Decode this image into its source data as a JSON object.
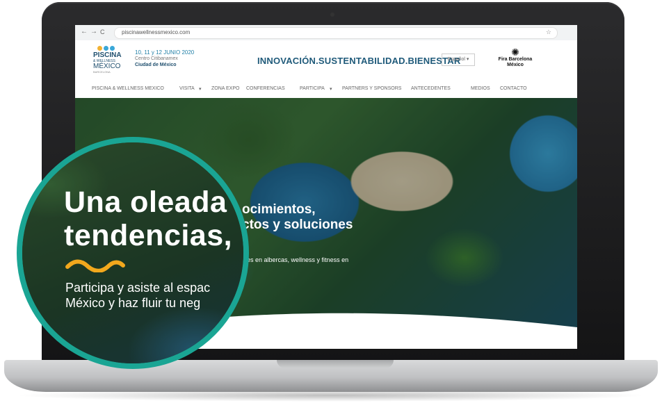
{
  "browser": {
    "url": "piscinawellnessmexico.com",
    "back_icon": "←",
    "forward_icon": "→",
    "reload_icon": "C",
    "star_icon": "☆"
  },
  "header": {
    "logo": {
      "line1": "PISCINA",
      "line2": "& WELLNESS",
      "line3": "MÉXICO",
      "line4": "BARCELONA",
      "dot_colors": [
        "#f2b233",
        "#3aa7d8",
        "#3aa7d8"
      ]
    },
    "event": {
      "dates": "10, 11 y 12 JUNIO 2020",
      "venue": "Centro Citibanamex",
      "city": "Ciudad de México"
    },
    "tagline": "INNOVACIÓN.SUSTENTABILIDAD.BIENESTAR",
    "language": "Español ▾",
    "partner": {
      "line1": "Fira Barcelona",
      "line2": "México"
    }
  },
  "menu": {
    "items": [
      "PISCINA & WELLNESS MEXICO",
      "VISITA",
      "ZONA EXPO",
      "CONFERENCIAS",
      "PARTICIPA",
      "PARTNERS Y SPONSORS",
      "ANTECEDENTES",
      "MEDIOS",
      "CONTACTO"
    ],
    "visita_caret": "▾",
    "participa_caret": "▾"
  },
  "hero": {
    "headline_line1": "ocimientos,",
    "headline_line2": "ctos y soluciones",
    "subtitle": "ales en albercas, wellness y fitness en"
  },
  "magnifier": {
    "headline_line1": "Una oleada",
    "headline_line2": "tendencias,",
    "sub_line1": "Participa y asiste al espac",
    "sub_line2": "México y haz fluir tu neg"
  },
  "colors": {
    "accent_teal": "#1aa594",
    "wave_yellow": "#f2a81d",
    "brand_blue": "#1f5a7a"
  }
}
